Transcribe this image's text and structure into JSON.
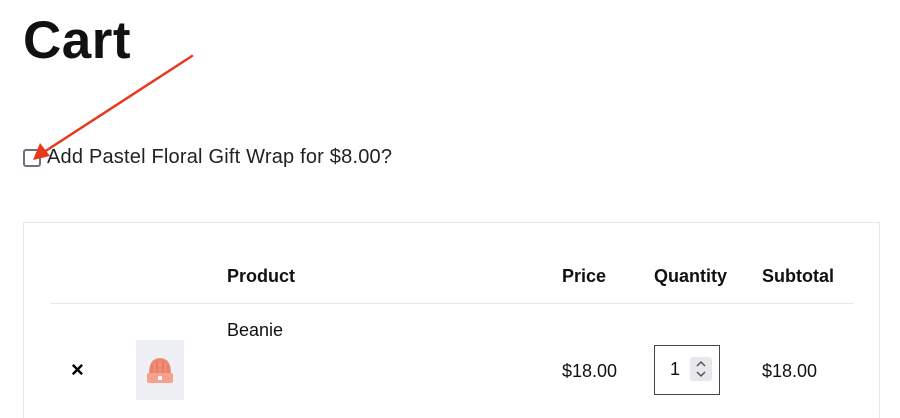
{
  "page": {
    "title": "Cart"
  },
  "gift_wrap": {
    "label": "Add Pastel Floral Gift Wrap for $8.00?",
    "checked": false
  },
  "annotation": {
    "arrow_color": "#e8391f"
  },
  "cart_table": {
    "headers": {
      "product": "Product",
      "price": "Price",
      "quantity": "Quantity",
      "subtotal": "Subtotal"
    },
    "rows": [
      {
        "remove_glyph": "×",
        "thumbnail_icon": "beanie-icon",
        "product": "Beanie",
        "price": "$18.00",
        "quantity": "1",
        "subtotal": "$18.00"
      }
    ]
  }
}
